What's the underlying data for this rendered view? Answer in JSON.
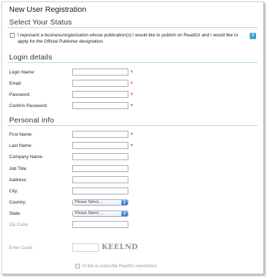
{
  "page": {
    "title": "New User Registration"
  },
  "status_section": {
    "title": "Select Your Status",
    "publisher_checkbox_text": "I represent a business/organization whose publication(s) I would like to publish on ReadOz and I would like to apply for the Official Publisher designation.",
    "help_icon": "?"
  },
  "login_section": {
    "title": "Login details",
    "fields": [
      {
        "label": "Login Name:",
        "value": "",
        "required": true
      },
      {
        "label": "Email:",
        "value": "",
        "required": true
      },
      {
        "label": "Password:",
        "value": "",
        "required": true
      },
      {
        "label": "Confirm Password:",
        "value": "",
        "required": true
      }
    ]
  },
  "personal_section": {
    "title": "Personal info",
    "fields": [
      {
        "label": "First Name:",
        "value": "",
        "required": true
      },
      {
        "label": "Last Name:",
        "value": "",
        "required": true
      },
      {
        "label": "Company Name:",
        "value": ""
      },
      {
        "label": "Job Title:",
        "value": ""
      },
      {
        "label": "Address:",
        "value": ""
      },
      {
        "label": "City:",
        "value": ""
      },
      {
        "label": "Country:",
        "selected": "Please Select ..."
      },
      {
        "label": "State:",
        "selected": "Please Select ..."
      },
      {
        "label": "Zip Code:",
        "value": ""
      }
    ]
  },
  "captcha": {
    "label": "Enter Code:",
    "code": "KEELND"
  },
  "newsletter": {
    "label": "I'd like to subscribe ReadOz newsletters"
  },
  "required_marker": "*",
  "colors": {
    "required": "#c0182a",
    "rule": "#a9d4e8",
    "help": "#3aa1d6"
  }
}
